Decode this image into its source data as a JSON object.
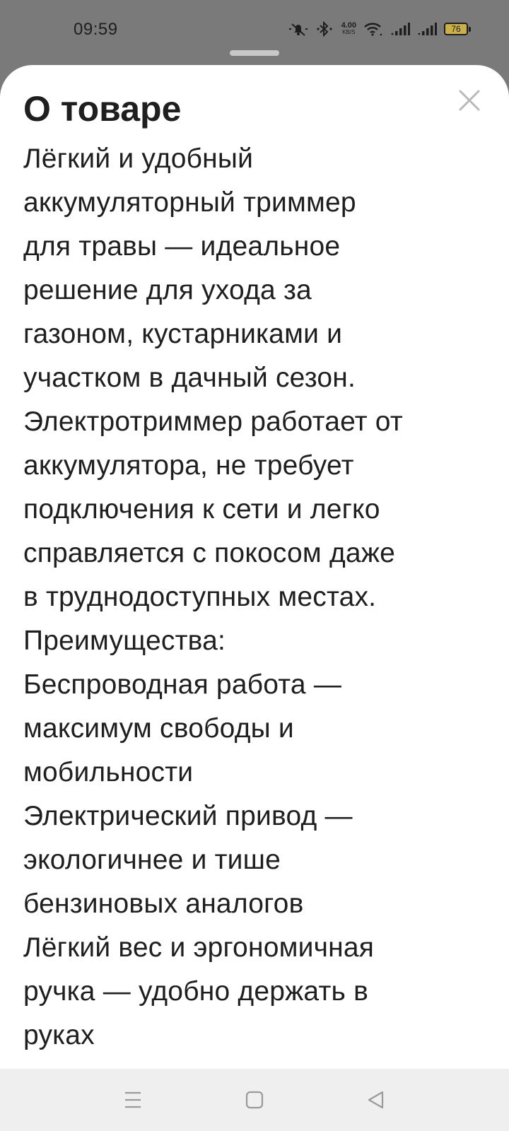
{
  "status_bar": {
    "time": "09:59",
    "net_speed_value": "4.00",
    "net_speed_unit": "KB/S",
    "battery_level": "76",
    "icons": [
      "mute-notifications-icon",
      "bluetooth-icon",
      "wifi-icon",
      "signal-icon",
      "signal-icon",
      "battery-icon"
    ]
  },
  "sheet": {
    "title": "О товаре",
    "close_icon": "close-icon",
    "description_lines": [
      "Лёгкий и удобный",
      "аккумуляторный триммер",
      "для травы — идеальное",
      "решение для ухода за",
      "газоном, кустарниками и",
      "участком в дачный сезон.",
      "Электротриммер работает от",
      "аккумулятора, не требует",
      "подключения к сети и легко",
      "справляется с покосом даже",
      "в труднодоступных местах.",
      "Преимущества:",
      "Беспроводная работа —",
      "максимум свободы и",
      "мобильности",
      "Электрический привод —",
      "экологичнее и тише",
      "бензиновых аналогов",
      "Лёгкий вес и эргономичная",
      "ручка — удобно держать в",
      "руках"
    ]
  },
  "nav_bar": {
    "icons": [
      "menu-icon",
      "home-square-icon",
      "back-triangle-icon"
    ]
  },
  "colors": {
    "background_dim": "#7a7a7a",
    "sheet_background": "#ffffff",
    "text": "#1f1f1f",
    "close_icon": "#b9b9b9",
    "nav_bar": "#efefef",
    "nav_icon": "#9a9a9a",
    "battery_fill": "#c9b04a"
  }
}
